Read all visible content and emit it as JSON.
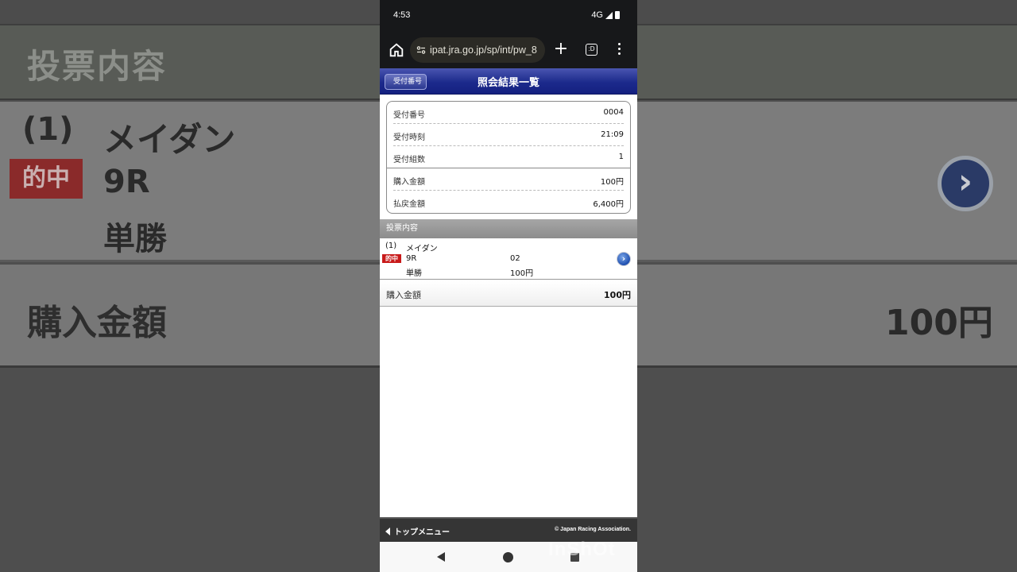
{
  "status_bar": {
    "time": "4:53",
    "network": "4G"
  },
  "browser": {
    "url": "ipat.jra.go.jp/sp/int/pw_8"
  },
  "header": {
    "back_label": "受付番号",
    "title": "照会結果一覧"
  },
  "receipt": {
    "rows": [
      {
        "label": "受付番号",
        "value": "0004"
      },
      {
        "label": "受付時刻",
        "value": "21:09"
      },
      {
        "label": "受付組数",
        "value": "1"
      },
      {
        "label": "購入金額",
        "value": "100円"
      },
      {
        "label": "払戻金額",
        "value": "6,400円"
      }
    ]
  },
  "bets": {
    "section_title": "投票内容",
    "item": {
      "number": "(1)",
      "hit_badge": "的中",
      "venue": "メイダン",
      "race": "9R",
      "bet_type": "単勝",
      "horse_number": "02",
      "amount": "100円"
    },
    "total_label": "購入金額",
    "total_value": "100円"
  },
  "footer": {
    "top_menu": "トップメニュー",
    "copyright": "© Japan Racing Association."
  },
  "watermark": "InShOt",
  "colors": {
    "title_bar": "#1c2a8c",
    "hit_badge": "#c81a1a",
    "footer": "#353535",
    "section_head": "#999999"
  }
}
